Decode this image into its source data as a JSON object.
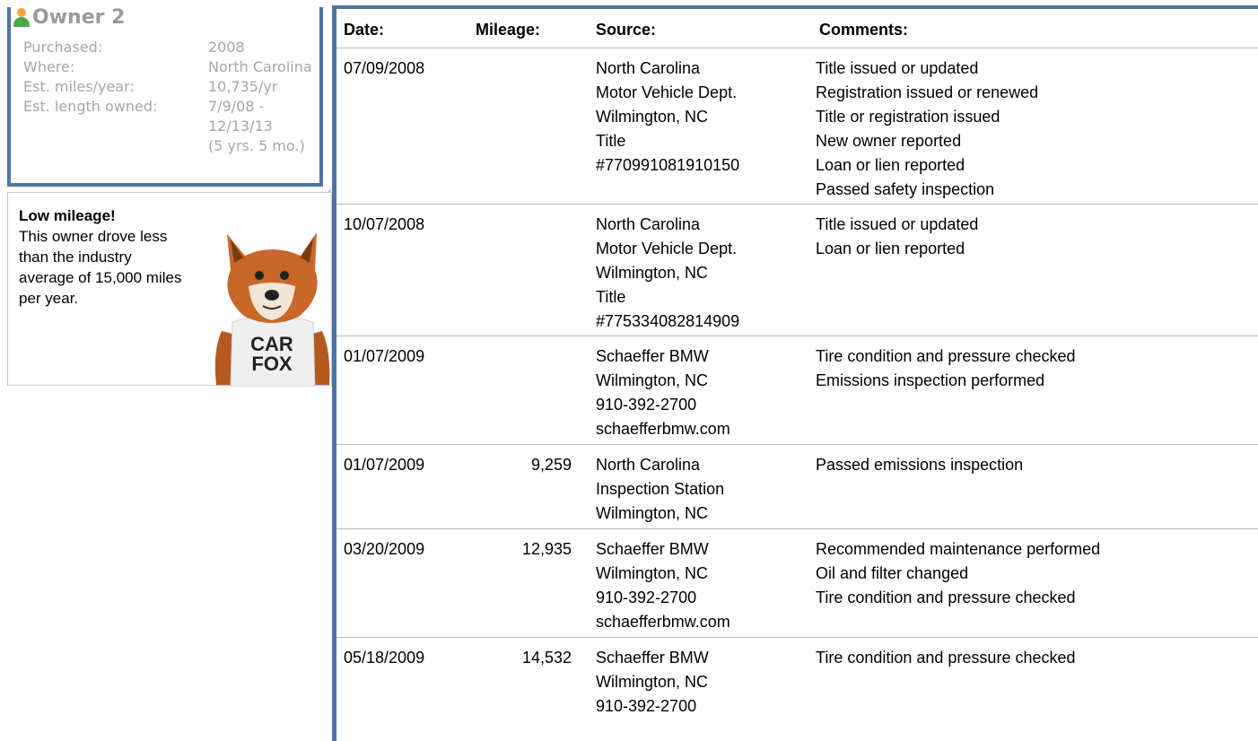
{
  "owner": {
    "title": "Owner 2",
    "icon": "person-icon",
    "rows": [
      {
        "label": "Purchased:",
        "values": [
          "2008"
        ]
      },
      {
        "label": "Where:",
        "values": [
          "North Carolina"
        ]
      },
      {
        "label": "Est. miles/year:",
        "values": [
          "10,735/yr"
        ]
      },
      {
        "label": "Est. length owned:",
        "values": [
          "7/9/08 -",
          "12/13/13",
          "(5 yrs. 5 mo.)"
        ]
      }
    ]
  },
  "callout": {
    "heading": "Low mileage!",
    "body": "This owner drove less than the industry average of 15,000 miles per year.",
    "shirt_line1": "CAR",
    "shirt_line2": "FOX"
  },
  "table": {
    "headers": {
      "date": "Date:",
      "mileage": "Mileage:",
      "source": "Source:",
      "comments": "Comments:"
    },
    "rows": [
      {
        "date": "07/09/2008",
        "mileage": "",
        "source": [
          "North Carolina",
          "Motor Vehicle Dept.",
          "Wilmington, NC",
          "Title",
          "#770991081910150"
        ],
        "comments": [
          "Title issued or updated",
          "Registration issued or renewed",
          "Title or registration issued",
          "New owner reported",
          "Loan or lien reported",
          "Passed safety inspection"
        ]
      },
      {
        "date": "10/07/2008",
        "mileage": "",
        "source": [
          "North Carolina",
          "Motor Vehicle Dept.",
          "Wilmington, NC",
          "Title",
          "#775334082814909"
        ],
        "comments": [
          "Title issued or updated",
          "Loan or lien reported"
        ]
      },
      {
        "date": "01/07/2009",
        "mileage": "",
        "source": [
          "Schaeffer BMW",
          "Wilmington, NC",
          "910-392-2700",
          "schaefferbmw.com"
        ],
        "comments": [
          "Tire condition and pressure checked",
          "Emissions inspection performed"
        ]
      },
      {
        "date": "01/07/2009",
        "mileage": "9,259",
        "source": [
          "North Carolina",
          "Inspection Station",
          "Wilmington, NC"
        ],
        "comments": [
          "Passed emissions inspection"
        ]
      },
      {
        "date": "03/20/2009",
        "mileage": "12,935",
        "source": [
          "Schaeffer BMW",
          "Wilmington, NC",
          "910-392-2700",
          "schaefferbmw.com"
        ],
        "comments": [
          "Recommended maintenance performed",
          "Oil and filter changed",
          "Tire condition and pressure checked"
        ]
      },
      {
        "date": "05/18/2009",
        "mileage": "14,532",
        "source": [
          "Schaeffer BMW",
          "Wilmington, NC",
          "910-392-2700"
        ],
        "comments": [
          "Tire condition and pressure checked"
        ]
      }
    ]
  },
  "colors": {
    "accent": "#4d74a4",
    "muted": "#a6a6a6"
  }
}
